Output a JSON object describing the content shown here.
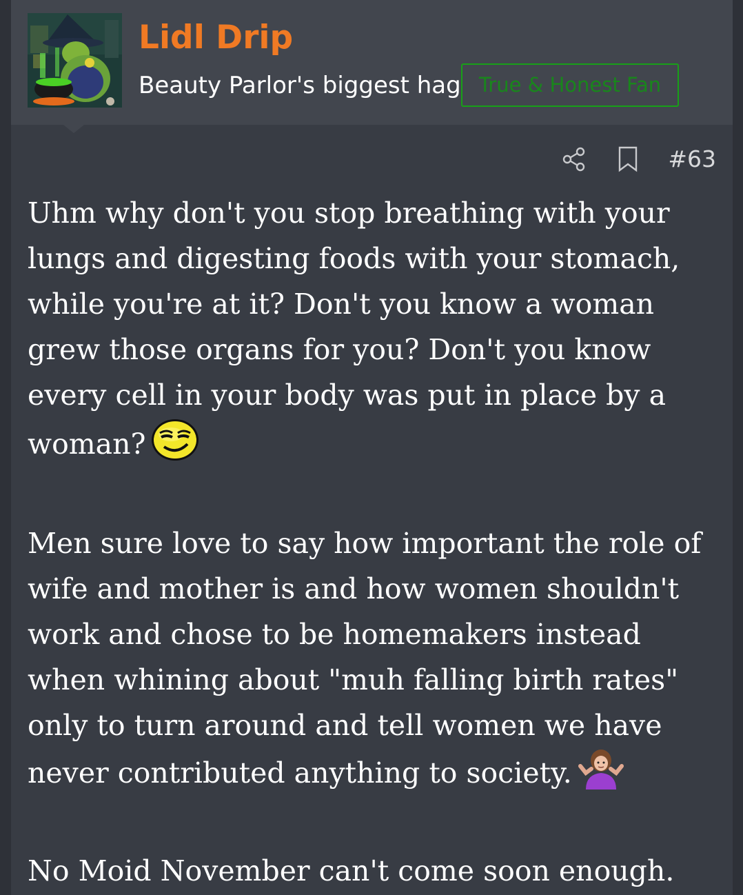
{
  "user": {
    "name": "Lidl Drip",
    "title": "Beauty Parlor's biggest hag",
    "badge": "True & Honest Fan"
  },
  "post": {
    "number": "#63",
    "actions": [
      {
        "icon": "share-icon"
      },
      {
        "icon": "bookmark-icon"
      }
    ],
    "paragraphs": [
      {
        "text": "Uhm why don't you stop breathing with your lungs and digesting foods with your stomach, while you're at it? Don't you know a woman grew those organs for you? Don't you know every cell in your body was put in place by a woman?",
        "emoji": "smug-smiley-emoji"
      },
      {
        "text": "Men sure love to say how important the role of wife and mother is and how women shouldn't work and chose to be homemakers instead when whining about \"muh falling birth rates\" only to turn around and tell women we have never contributed anything to society.",
        "emoji": "woman-shrugging-emoji"
      },
      {
        "text": "No Moid November can't come soon enough."
      }
    ]
  },
  "colors": {
    "username": "#f07a24",
    "badge_border": "#18a018",
    "badge_text": "#19861c",
    "header_bg": "#42464e",
    "post_bg": "#383c44"
  }
}
